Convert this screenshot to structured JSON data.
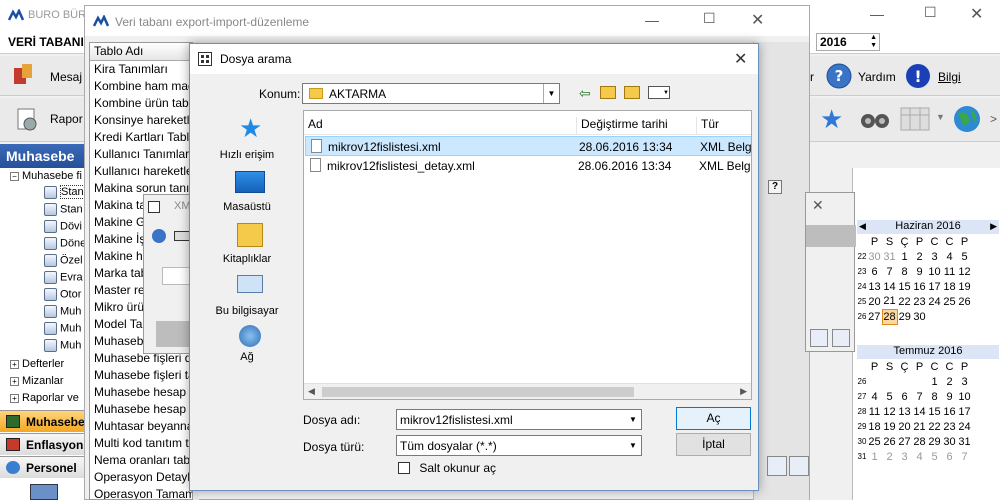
{
  "main_window": {
    "title": "BURO BÜR",
    "menu_label": "VERİ TABANI",
    "year": "2016",
    "toolbar": {
      "mesaj": "Mesaj",
      "rapor": "Rapor",
      "yardim": "Yardım",
      "bilgi": "Bilgi"
    },
    "nav_header": "Muhasebe",
    "tree": {
      "root": "Muhasebe fi",
      "children": [
        "Stan",
        "Stan",
        "Dövi",
        "Döne",
        "Özel",
        "Evra",
        "Otor",
        "Muh",
        "Muh",
        "Muh"
      ],
      "others": [
        "Defterler",
        "Mizanlar",
        "Raporlar ve"
      ]
    },
    "bottom_nav": [
      "Muhasebe",
      "Enflasyon",
      "Personel"
    ],
    "calendar_june": {
      "title": "Haziran 2016",
      "weekdays": [
        "P",
        "S",
        "Ç",
        "P",
        "C",
        "C",
        "P"
      ],
      "weeks": [
        {
          "wk": "22",
          "days": [
            "30",
            "31",
            "1",
            "2",
            "3",
            "4",
            "5"
          ]
        },
        {
          "wk": "23",
          "days": [
            "6",
            "7",
            "8",
            "9",
            "10",
            "11",
            "12"
          ]
        },
        {
          "wk": "24",
          "days": [
            "13",
            "14",
            "15",
            "16",
            "17",
            "18",
            "19"
          ]
        },
        {
          "wk": "25",
          "days": [
            "20",
            "21",
            "22",
            "23",
            "24",
            "25",
            "26"
          ]
        },
        {
          "wk": "26",
          "days": [
            "27",
            "28",
            "29",
            "30",
            "",
            "",
            ""
          ]
        }
      ],
      "selected": "28"
    },
    "calendar_july": {
      "title": "Temmuz 2016",
      "weekdays": [
        "P",
        "S",
        "Ç",
        "P",
        "C",
        "C",
        "P"
      ],
      "weeks": [
        {
          "wk": "26",
          "days": [
            "",
            "",
            "",
            "",
            "1",
            "2",
            "3"
          ]
        },
        {
          "wk": "27",
          "days": [
            "4",
            "5",
            "6",
            "7",
            "8",
            "9",
            "10"
          ]
        },
        {
          "wk": "28",
          "days": [
            "11",
            "12",
            "13",
            "14",
            "15",
            "16",
            "17"
          ]
        },
        {
          "wk": "29",
          "days": [
            "18",
            "19",
            "20",
            "21",
            "22",
            "23",
            "24"
          ]
        },
        {
          "wk": "30",
          "days": [
            "25",
            "26",
            "27",
            "28",
            "29",
            "30",
            "31"
          ]
        },
        {
          "wk": "31",
          "days": [
            "1",
            "2",
            "3",
            "4",
            "5",
            "6",
            "7"
          ]
        }
      ]
    }
  },
  "export_window": {
    "title": "Veri tabanı export-import-düzenleme",
    "column_header": "Tablo Adı",
    "tables": [
      "Kira Tanımları",
      "Kombine ham madd",
      "Kombine ürün tablo",
      "Konsinye hareketler",
      "Kredi Kartları Tablos",
      "Kullanıcı Tanımları Ta",
      "Kullanıcı hareketleri",
      "Makina sorun tanım",
      "Makina tab",
      "Makine Gr",
      "Makine İşe",
      "Makine ha",
      "Marka tab",
      "Master reg",
      "Mikro ürün",
      "Model Tab",
      "Muhasebe",
      "Muhasebe fişleri de",
      "Muhasebe fişleri tab",
      "Muhasebe hesap pl",
      "Muhasebe hesap pl",
      "Muhtasar beyannam",
      "Multi kod tanıtım tab",
      "Nema oranları tablo",
      "Operasyon Detayla",
      "Operasyon Tamaml"
    ],
    "sub_title": "XM"
  },
  "file_dialog": {
    "title": "Dosya arama",
    "location_label": "Konum:",
    "location_value": "AKTARMA",
    "places": [
      "Hızlı erişim",
      "Masaüstü",
      "Kitaplıklar",
      "Bu bilgisayar",
      "Ağ"
    ],
    "columns": [
      "Ad",
      "Değiştirme tarihi",
      "Tür"
    ],
    "files": [
      {
        "name": "mikrov12fislistesi.xml",
        "date": "28.06.2016 13:34",
        "type": "XML Belge"
      },
      {
        "name": "mikrov12fislistesi_detay.xml",
        "date": "28.06.2016 13:34",
        "type": "XML Belge"
      }
    ],
    "filename_label": "Dosya adı:",
    "filename_value": "mikrov12fislistesi.xml",
    "filetype_label": "Dosya türü:",
    "filetype_value": "Tüm dosyalar (*.*)",
    "readonly_label": "Salt okunur aç",
    "open_button": "Aç",
    "cancel_button": "İptal"
  }
}
